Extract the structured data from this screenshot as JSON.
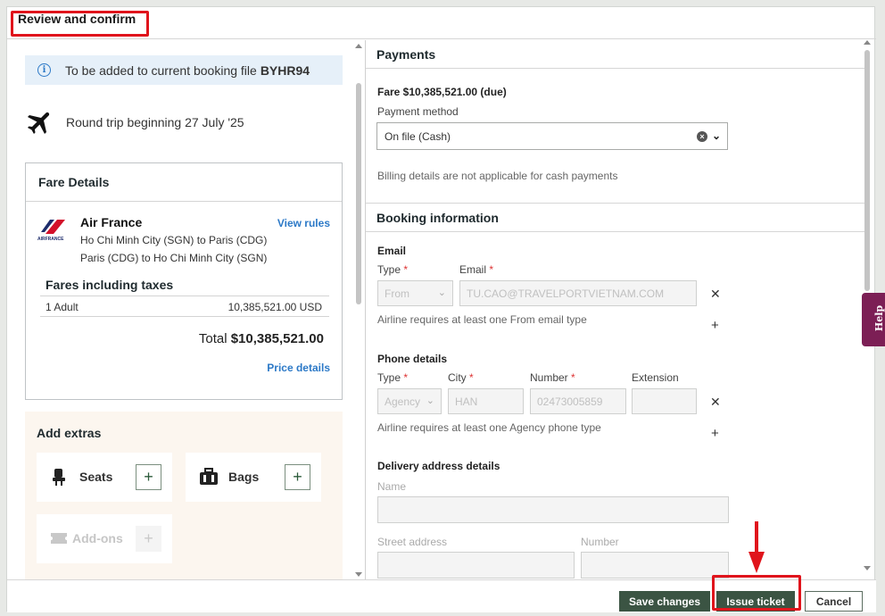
{
  "header": {
    "title": "Review and confirm"
  },
  "left": {
    "info_text": "To be added to current booking file",
    "booking_file": "BYHR94",
    "trip_text": "Round trip beginning 27 July '25",
    "fare_details": {
      "title": "Fare Details",
      "airline": "Air France",
      "logo_text": "AIRFRANCE",
      "view_rules": "View rules",
      "route_1": "Ho Chi Minh City (SGN) to Paris (CDG)",
      "route_2": "Paris (CDG) to Ho Chi Minh City (SGN)",
      "fares_title": "Fares including taxes",
      "passenger": "1 Adult",
      "passenger_fare": "10,385,521.00 USD",
      "total_label": "Total",
      "total_value": "$10,385,521.00",
      "price_details": "Price details"
    },
    "extras": {
      "title": "Add extras",
      "seats": "Seats",
      "bags": "Bags",
      "addons": "Add-ons"
    }
  },
  "right": {
    "payments": {
      "title": "Payments",
      "fare_due": "Fare $10,385,521.00 (due)",
      "method_label": "Payment method",
      "method_value": "On file (Cash)",
      "billing_note": "Billing details are not applicable for cash payments"
    },
    "booking_info": {
      "title": "Booking information",
      "email_title": "Email",
      "type_label": "Type",
      "email_label": "Email",
      "email_type_value": "From",
      "email_value": "TU.CAO@TRAVELPORTVIETNAM.COM",
      "email_note": "Airline requires at least one From email type",
      "phone_title": "Phone details",
      "city_label": "City",
      "number_label": "Number",
      "extension_label": "Extension",
      "phone_type_value": "Agency",
      "city_value": "HAN",
      "number_value": "02473005859",
      "phone_note": "Airline requires at least one Agency phone type",
      "delivery_title": "Delivery address details",
      "name_label": "Name",
      "street_label": "Street address",
      "street_number_label": "Number"
    }
  },
  "help_label": "Help",
  "footer": {
    "save": "Save changes",
    "issue": "Issue ticket",
    "cancel": "Cancel"
  },
  "colors": {
    "accent": "#3b5443",
    "link": "#2c79c7",
    "highlight": "#e0141c",
    "help": "#7c1f55"
  }
}
